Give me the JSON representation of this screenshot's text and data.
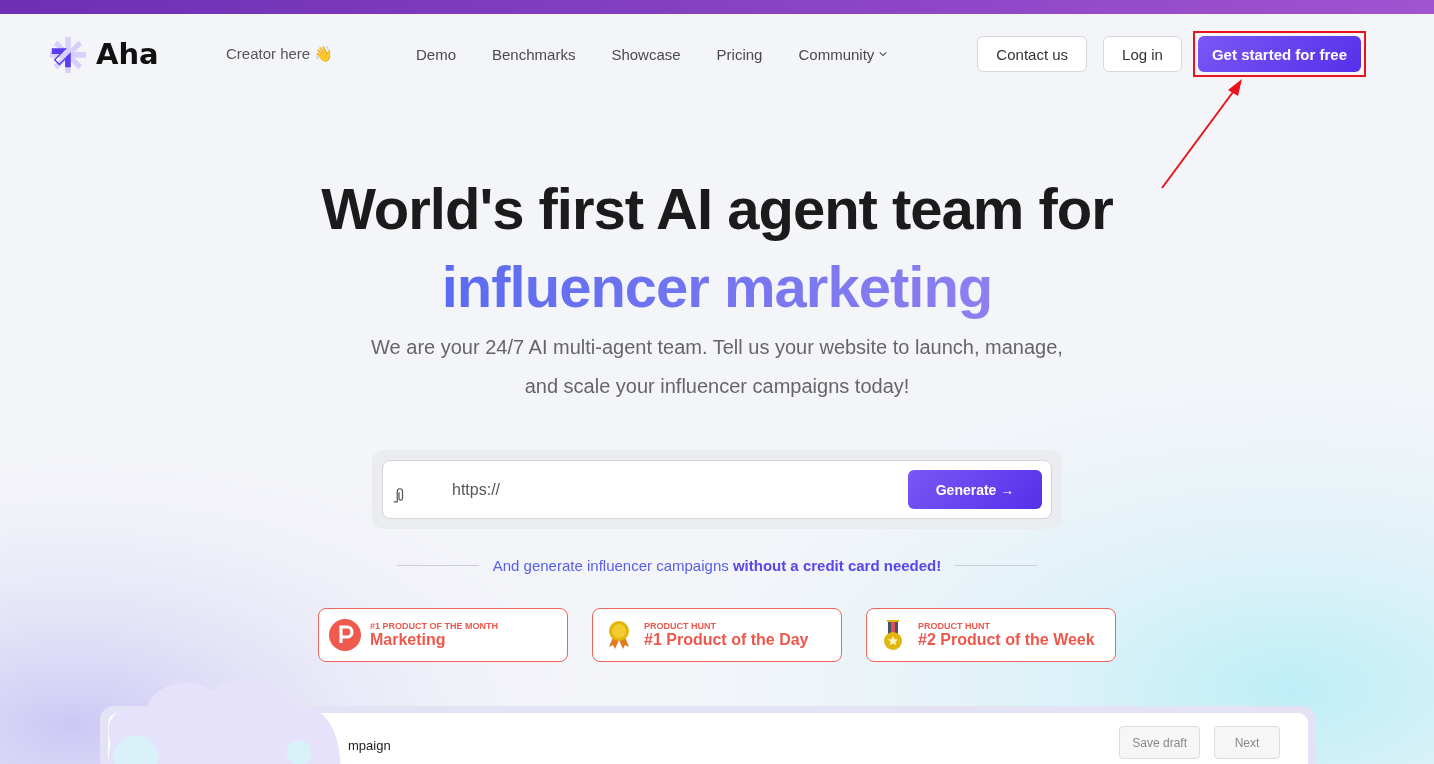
{
  "nav": {
    "brand": "Aha",
    "creator_link": "Creator here 👋",
    "links": [
      {
        "label": "Demo",
        "kind": "link"
      },
      {
        "label": "Benchmarks",
        "kind": "link"
      },
      {
        "label": "Showcase",
        "kind": "link"
      },
      {
        "label": "Pricing",
        "kind": "link"
      },
      {
        "label": "Community",
        "kind": "dropdown"
      }
    ],
    "buttons": [
      {
        "label": "Contact us",
        "kind": "outline",
        "highlighted": false
      },
      {
        "label": "Log in",
        "kind": "outline",
        "highlighted": false
      },
      {
        "label": "Get started for free",
        "kind": "primary",
        "highlighted": true
      }
    ]
  },
  "hero": {
    "title": "World's first AI agent team for",
    "title_accent": "influencer marketing",
    "subtitle": "We are your 24/7 AI multi-agent team. Tell us your website to launch, manage, and scale your influencer campaigns today!"
  },
  "url_form": {
    "value": "https://",
    "button": "Generate →"
  },
  "tagline": "And generate influencer campaigns **without a credit card needed!**",
  "awards": [
    {
      "kind": "p",
      "caption": "#1 PRODUCT OF THE MONTH",
      "title": "Marketing"
    },
    {
      "kind": "medal",
      "caption": "PRODUCT HUNT",
      "title": "#1 Product of the Day"
    },
    {
      "kind": "ribbon",
      "caption": "PRODUCT HUNT",
      "title": "#2 Product of the Week"
    }
  ],
  "preview": {
    "title": "mpaign",
    "buttons": [
      "Save draft",
      "Next"
    ]
  }
}
